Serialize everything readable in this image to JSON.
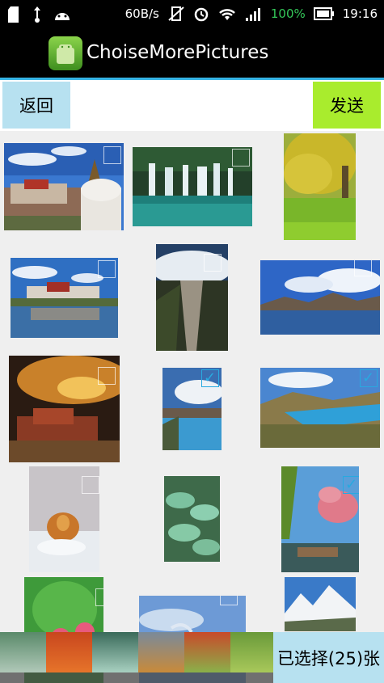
{
  "status_bar": {
    "speed": "60B/s",
    "battery": "100%",
    "time": "19:16",
    "icons": [
      "sd-card-icon",
      "usb-icon",
      "android-icon",
      "vibrate-mute-icon",
      "alarm-icon",
      "wifi-icon",
      "signal-icon",
      "battery-icon"
    ]
  },
  "app": {
    "title": "ChoiseMorePictures",
    "accent_color": "#36b4e5"
  },
  "actions": {
    "back_label": "返回",
    "send_label": "发送"
  },
  "grid": {
    "photos": [
      {
        "scene": "potala-palace-stupa",
        "selected": false
      },
      {
        "scene": "waterfall-pool",
        "selected": false
      },
      {
        "scene": "ginkgo-tree",
        "selected": false
      },
      {
        "scene": "potala-lake-reflection",
        "selected": false
      },
      {
        "scene": "aerial-river-valley",
        "selected": false
      },
      {
        "scene": "lake-mountains-clouds",
        "selected": false
      },
      {
        "scene": "potala-sunset",
        "selected": false
      },
      {
        "scene": "blue-lake-clouds",
        "selected": true
      },
      {
        "scene": "turquoise-lake-hills",
        "selected": true
      },
      {
        "scene": "tiger-in-snow",
        "selected": false
      },
      {
        "scene": "green-terraced-pools",
        "selected": false
      },
      {
        "scene": "peach-blossom-village",
        "selected": true
      },
      {
        "scene": "bleeding-heart-flowers",
        "selected": false
      },
      {
        "scene": "sky-bird",
        "selected": false
      },
      {
        "scene": "snow-mountains",
        "selected": false
      }
    ]
  },
  "selection_tray": {
    "count_label": "已选择(25)张",
    "count": 25
  }
}
